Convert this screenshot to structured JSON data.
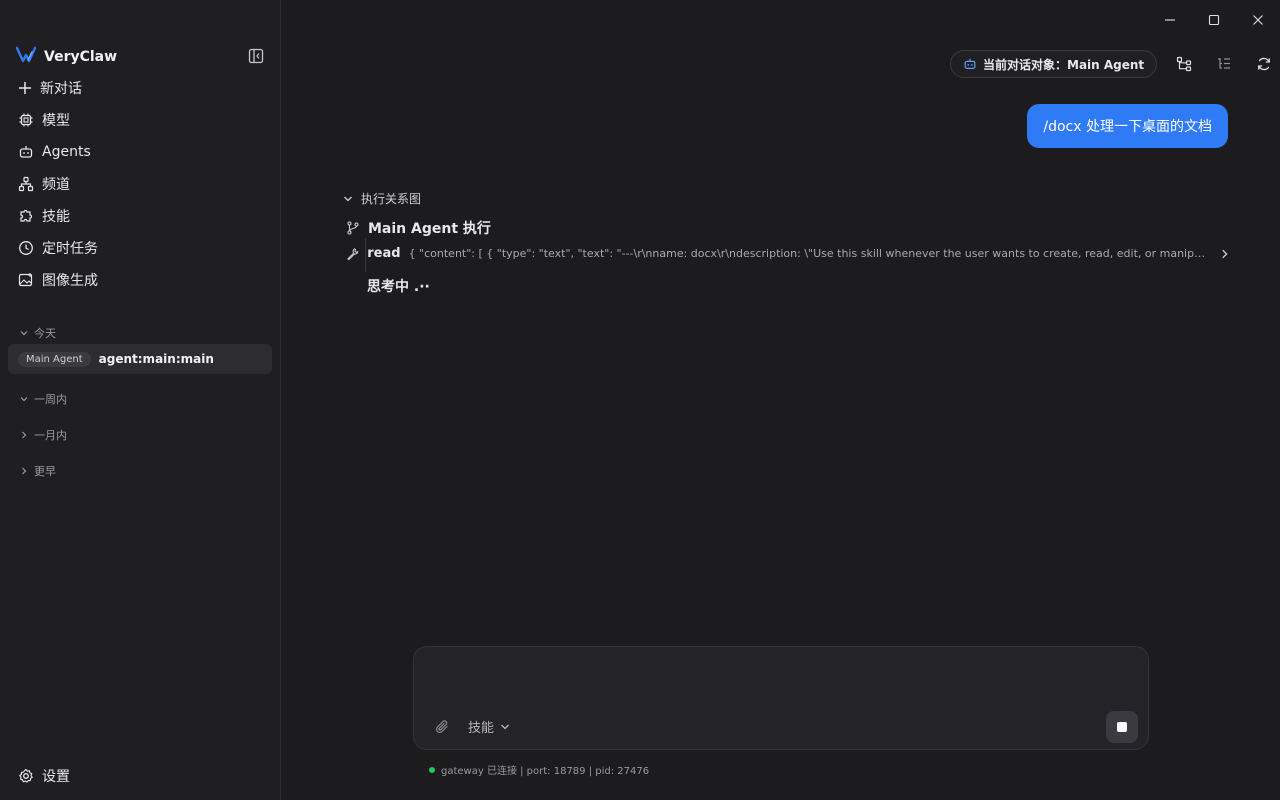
{
  "app": {
    "name": "VeryClaw",
    "brand_color": "#2f7bf5"
  },
  "sidebar": {
    "nav": [
      {
        "label": "新对话",
        "icon": "plus-icon"
      },
      {
        "label": "模型",
        "icon": "chip-icon"
      },
      {
        "label": "Agents",
        "icon": "robot-icon"
      },
      {
        "label": "频道",
        "icon": "network-icon"
      },
      {
        "label": "技能",
        "icon": "puzzle-icon"
      },
      {
        "label": "定时任务",
        "icon": "clock-icon"
      },
      {
        "label": "图像生成",
        "icon": "image-icon"
      }
    ],
    "groups": {
      "today": "今天",
      "week": "一周内",
      "month": "一月内",
      "earlier": "更早"
    },
    "session": {
      "badge": "Main Agent",
      "name": "agent:main:main"
    },
    "settings_label": "设置"
  },
  "header": {
    "target_label": "当前对话对象：Main Agent"
  },
  "chat": {
    "user_message": "/docx  处理一下桌面的文档",
    "exec_graph_label": "执行关系图",
    "agent_exec_label": "Main Agent 执行",
    "tool": {
      "name": "read",
      "args": "{ \"content\": [ { \"type\": \"text\", \"text\": \"---\\r\\nname: docx\\r\\ndescription: \\\"Use this skill whenever the user wants to create, read, edit, or manipulate Wor..."
    },
    "thinking_label": "思考中 .··"
  },
  "composer": {
    "input_value": "",
    "skills_label": "技能"
  },
  "status": {
    "text": "gateway 已连接 | port: 18789 | pid: 27476",
    "dot_color": "#22c55e"
  }
}
